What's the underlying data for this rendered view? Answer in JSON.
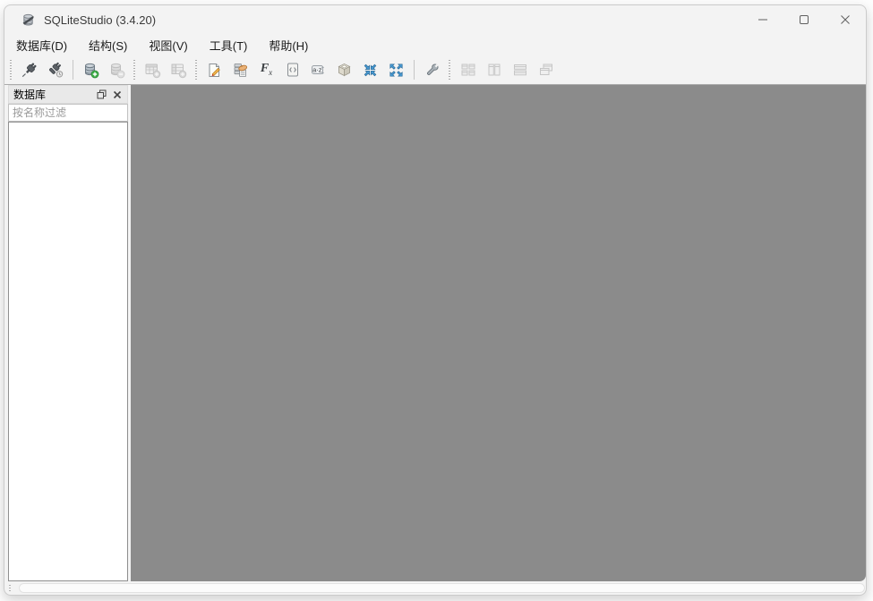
{
  "window": {
    "title": "SQLiteStudio (3.4.20)",
    "app_icon": "sqlitestudio-database-icon",
    "controls": [
      "minimize",
      "maximize",
      "close"
    ]
  },
  "menu": {
    "items": [
      "数据库(D)",
      "结构(S)",
      "视图(V)",
      "工具(T)",
      "帮助(H)"
    ]
  },
  "toolbar": {
    "groups": [
      {
        "items": [
          {
            "icon": "connect-icon",
            "enabled": true
          },
          {
            "icon": "disconnect-icon",
            "enabled": true
          },
          {
            "icon": "add-database-icon",
            "enabled": true
          },
          {
            "icon": "remove-database-icon",
            "enabled": false
          }
        ]
      },
      {
        "items": [
          {
            "icon": "new-table-icon",
            "enabled": false
          },
          {
            "icon": "new-view-icon",
            "enabled": false
          }
        ]
      },
      {
        "items": [
          {
            "icon": "sql-editor-icon",
            "enabled": true
          },
          {
            "icon": "ddl-history-icon",
            "enabled": true
          },
          {
            "icon": "functions-editor-icon",
            "enabled": true
          },
          {
            "icon": "sql-code-icon",
            "enabled": true
          },
          {
            "icon": "collations-editor-icon",
            "enabled": true
          },
          {
            "icon": "extensions-package-icon",
            "enabled": true
          },
          {
            "icon": "import-arrows-icon",
            "enabled": true
          },
          {
            "icon": "export-arrows-icon",
            "enabled": true
          },
          {
            "icon": "config-wrench-icon",
            "enabled": true
          }
        ]
      },
      {
        "items": [
          {
            "icon": "tile-windows-icon",
            "enabled": false
          },
          {
            "icon": "tile-vertical-icon",
            "enabled": false
          },
          {
            "icon": "tile-horizontal-icon",
            "enabled": false
          },
          {
            "icon": "cascade-windows-icon",
            "enabled": false
          }
        ]
      }
    ],
    "fx_label": "Fx",
    "collation_label": "a·z",
    "code_label": "<>"
  },
  "dock": {
    "title": "数据库",
    "filter_placeholder": "按名称过滤",
    "items": []
  },
  "colors": {
    "mdi_background": "#8b8b8b",
    "chrome_background": "#f3f3f3",
    "dock_header_background": "#e9e9e9",
    "add_green": "#3fae49",
    "arrow_blue": "#4a9bd4",
    "pencil_orange": "#f0b34e"
  }
}
